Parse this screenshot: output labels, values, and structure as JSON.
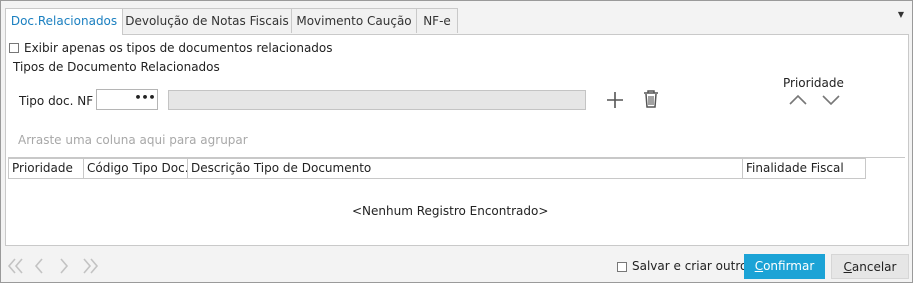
{
  "tabs": [
    {
      "label": "Doc.Relacionados",
      "active": true
    },
    {
      "label": "Devolução de Notas Fiscais",
      "active": false
    },
    {
      "label": "Movimento Caução",
      "active": false
    },
    {
      "label": "NF-e",
      "active": false
    }
  ],
  "tab_menu_icon": "caret-down-icon",
  "filter": {
    "show_only_related_label": "Exibir apenas os tipos de documentos relacionados",
    "checked": false
  },
  "section_title": "Tipos de Documento Relacionados",
  "tipo_doc": {
    "label": "Tipo doc. NF",
    "value": "",
    "lookup_label": "•••",
    "description_value": ""
  },
  "actions": {
    "add_icon": "plus-icon",
    "delete_icon": "trash-icon"
  },
  "priority": {
    "label": "Prioridade",
    "up_icon": "chevron-up-icon",
    "down_icon": "chevron-down-icon"
  },
  "group_hint": "Arraste uma coluna aqui para agrupar",
  "grid": {
    "columns": [
      "Prioridade",
      "Código Tipo Doc.",
      "Descrição Tipo de Documento",
      "Finalidade Fiscal"
    ],
    "rows": [],
    "empty_message": "<Nenhum Registro Encontrado>"
  },
  "footer": {
    "nav_icons": [
      "first-page-icon",
      "prev-page-icon",
      "next-page-icon",
      "last-page-icon"
    ],
    "save_and_create_label": "Salvar e criar outro",
    "save_and_create_checked": false,
    "confirm_label": "Confirmar",
    "confirm_accent": "C",
    "confirm_rest": "onfirmar",
    "cancel_label": "Cancelar",
    "cancel_accent": "C",
    "cancel_rest": "ancelar"
  },
  "colors": {
    "accent": "#1ca3d6",
    "tab_active_text": "#1a7fc0",
    "hint_text": "#a8a8a8"
  }
}
